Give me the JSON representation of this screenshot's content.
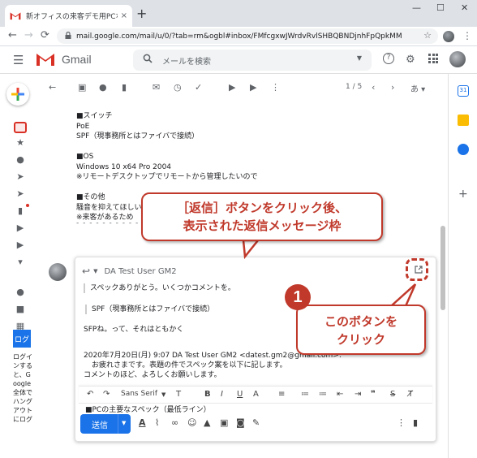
{
  "browser": {
    "tab_title": "新オフィスの来客デモ用PCなどのスペ",
    "tab_close": "×",
    "new_tab": "+",
    "min": "—",
    "max": "☐",
    "close": "✕",
    "back": "←",
    "forward": "→",
    "reload": "⟳",
    "lock": "🔒",
    "url": "mail.google.com/mail/u/0/?tab=rm&ogbl#inbox/FMfcgxwJWrdvRvlSHBQBNDjnhFpQpkMM",
    "star": "☆",
    "menu": "⋮"
  },
  "gmail": {
    "title": "Gmail",
    "search_placeholder": "メールを検索",
    "search_icon": "🔍",
    "help_icon": "?",
    "settings_icon": "⚙",
    "pager": "1 / 5",
    "lang_toggle": "あ ▾",
    "brand_color": "#d93025",
    "accent_color": "#1a73e8"
  },
  "rail": {
    "blue_label": "ログ",
    "side_text": "ログインすると、Google全体でハングアウトにログ"
  },
  "email_body": {
    "lines": [
      "■スイッチ",
      "PoE",
      "SPF（現事務所とはファイバで接続）",
      "",
      "■OS",
      "Windows 10 x64 Pro 2004",
      "※リモートデスクトップでリモートから管理したいので",
      "",
      "■その他",
      "騒音を抑えてほしい",
      "※来客があるため"
    ],
    "divider": "- - - - - - - - - - - - - -"
  },
  "reply": {
    "sender": "DA Test User GM2",
    "quote1": "スペックありがとう。いくつかコメントを。",
    "quote2": "SPF（現事務所とはファイバで接続）",
    "line3": "SFPね。って、それはともかく",
    "header_line": "2020年7月20日(月) 9:07 DA Test User GM2 <datest.gm2@gmail.com>:",
    "q_line1": "お疲れさまです。表題の件でスペック案を以下に記します。",
    "q_line2": "コメントのほど、よろしくお願いします。",
    "partial_line": "■PCの主要なスペック（最低ライン）",
    "font_name": "Sans Serif",
    "send_label": "送信"
  },
  "callouts": {
    "top_line1": "［返信］ボタンをクリック後、",
    "top_line2": "表示された返信メッセージ枠",
    "badge": "1",
    "right_line1": "このボタンを",
    "right_line2": "クリック",
    "color": "#c0392b"
  }
}
